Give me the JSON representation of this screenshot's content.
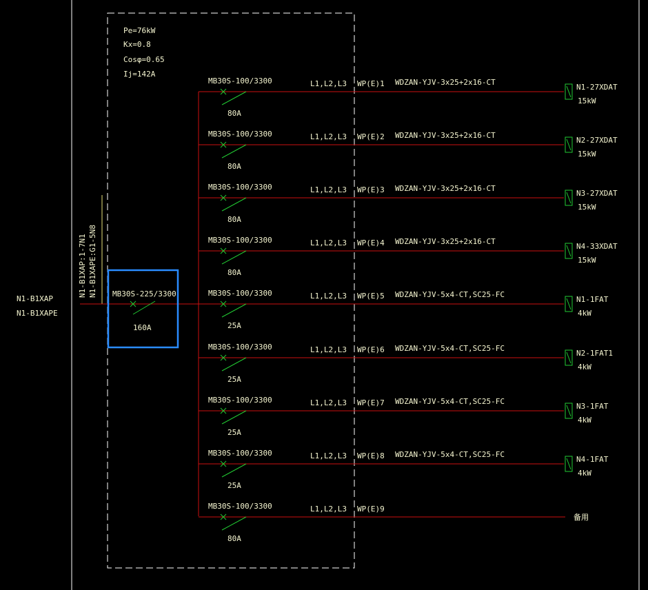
{
  "colors": {
    "background": "#000000",
    "frame": "#ffffff",
    "feeder": "#cc1111",
    "breaker": "#22cc33",
    "text": "#f5f5d0",
    "yellow": "#e8e27a",
    "selection": "#2a8cff"
  },
  "incoming": {
    "label_ap": "N1-B1XAP",
    "label_ape": "N1-B1XAPE",
    "vertical_label_1": "N1-B1XAP:1-7N1",
    "vertical_label_2": "N1-B1XAPE:G1-5N8"
  },
  "panel": {
    "pe": "Pe=76kW",
    "kx": "Kx=0.8",
    "cos": "Cosφ=0.65",
    "ij": "Ij=142A"
  },
  "main_breaker": {
    "model": "MB30S-225/3300",
    "rating": "160A"
  },
  "circuits": [
    {
      "model": "MB30S-100/3300",
      "rating": "80A",
      "phases": "L1,L2,L3",
      "circuit_id": "WP(E)1",
      "cable": "WDZAN-YJV-3x25+2x16-CT",
      "load": "N1-27XDAT",
      "power": "15kW"
    },
    {
      "model": "MB30S-100/3300",
      "rating": "80A",
      "phases": "L1,L2,L3",
      "circuit_id": "WP(E)2",
      "cable": "WDZAN-YJV-3x25+2x16-CT",
      "load": "N2-27XDAT",
      "power": "15kW"
    },
    {
      "model": "MB30S-100/3300",
      "rating": "80A",
      "phases": "L1,L2,L3",
      "circuit_id": "WP(E)3",
      "cable": "WDZAN-YJV-3x25+2x16-CT",
      "load": "N3-27XDAT",
      "power": "15kW"
    },
    {
      "model": "MB30S-100/3300",
      "rating": "80A",
      "phases": "L1,L2,L3",
      "circuit_id": "WP(E)4",
      "cable": "WDZAN-YJV-3x25+2x16-CT",
      "load": "N4-33XDAT",
      "power": "15kW"
    },
    {
      "model": "MB30S-100/3300",
      "rating": "25A",
      "phases": "L1,L2,L3",
      "circuit_id": "WP(E)5",
      "cable": "WDZAN-YJV-5x4-CT,SC25-FC",
      "load": "N1-1FAT",
      "power": "4kW"
    },
    {
      "model": "MB30S-100/3300",
      "rating": "25A",
      "phases": "L1,L2,L3",
      "circuit_id": "WP(E)6",
      "cable": "WDZAN-YJV-5x4-CT,SC25-FC",
      "load": "N2-1FAT1",
      "power": "4kW"
    },
    {
      "model": "MB30S-100/3300",
      "rating": "25A",
      "phases": "L1,L2,L3",
      "circuit_id": "WP(E)7",
      "cable": "WDZAN-YJV-5x4-CT,SC25-FC",
      "load": "N3-1FAT",
      "power": "4kW"
    },
    {
      "model": "MB30S-100/3300",
      "rating": "25A",
      "phases": "L1,L2,L3",
      "circuit_id": "WP(E)8",
      "cable": "WDZAN-YJV-5x4-CT,SC25-FC",
      "load": "N4-1FAT",
      "power": "4kW"
    },
    {
      "model": "MB30S-100/3300",
      "rating": "80A",
      "phases": "L1,L2,L3",
      "circuit_id": "WP(E)9",
      "cable": "",
      "load": "",
      "power": "",
      "spare": "备用"
    }
  ]
}
